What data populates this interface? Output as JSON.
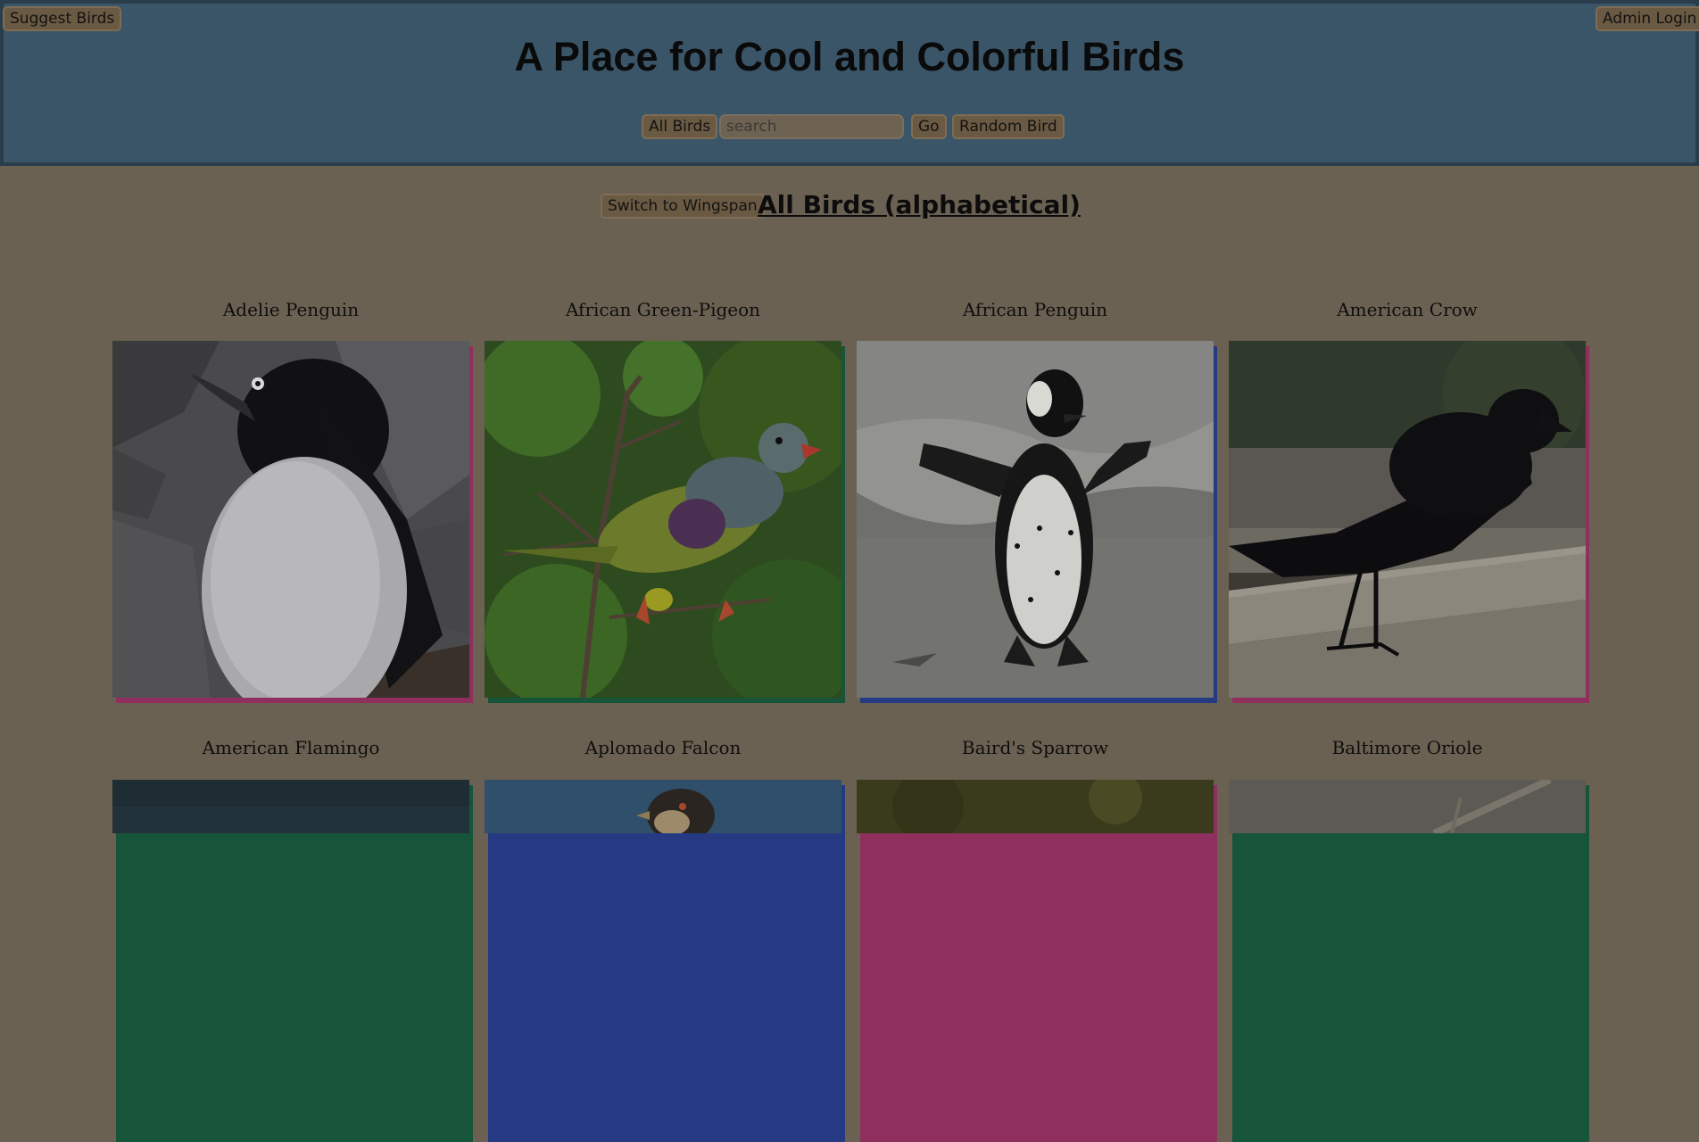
{
  "header": {
    "title": "A Place for Cool and Colorful Birds",
    "suggest_label": "Suggest Birds",
    "admin_label": "Admin Login",
    "all_birds_label": "All Birds",
    "search_placeholder": "search",
    "go_label": "Go",
    "random_label": "Random Bird"
  },
  "main": {
    "switch_label": "Switch to Wingspan",
    "section_title": "All Birds (alphabetical)"
  },
  "birds": [
    {
      "name": "Adelie Penguin",
      "accent": "#8e2f5e"
    },
    {
      "name": "African Green-Pigeon",
      "accent": "#17553a"
    },
    {
      "name": "African Penguin",
      "accent": "#263a84"
    },
    {
      "name": "American Crow",
      "accent": "#8e2f5e"
    },
    {
      "name": "American Flamingo",
      "accent": "#17553a"
    },
    {
      "name": "Aplomado Falcon",
      "accent": "#263a84"
    },
    {
      "name": "Baird's Sparrow",
      "accent": "#8e2f5e"
    },
    {
      "name": "Baltimore Oriole",
      "accent": "#17553a"
    }
  ]
}
